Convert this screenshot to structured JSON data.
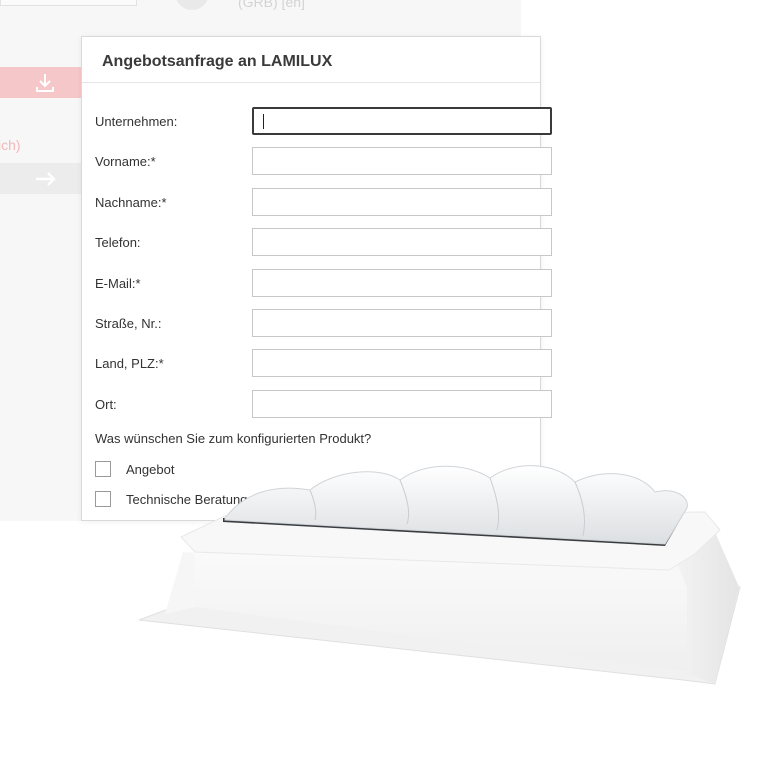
{
  "background": {
    "top_text": "(GRB) [en]",
    "red_text": "ich)",
    "download_icon": "download-icon",
    "arrow_icon": "arrow-right-icon"
  },
  "dialog": {
    "title": "Angebotsanfrage an LAMILUX",
    "fields": [
      {
        "label": "Unternehmen:",
        "value": ""
      },
      {
        "label": "Vorname:*",
        "value": ""
      },
      {
        "label": "Nachname:*",
        "value": ""
      },
      {
        "label": "Telefon:",
        "value": ""
      },
      {
        "label": "E-Mail:*",
        "value": ""
      },
      {
        "label": "Straße, Nr.:",
        "value": ""
      },
      {
        "label": "Land, PLZ:*",
        "value": ""
      },
      {
        "label": "Ort:",
        "value": ""
      }
    ],
    "question": "Was wünschen Sie zum konfigurierten Produkt?",
    "options": [
      {
        "label": "Angebot",
        "checked": false
      },
      {
        "label": "Technische Beratung",
        "checked": false
      }
    ]
  },
  "colors": {
    "accent_pink": "#f6c7c9",
    "text": "#333333"
  }
}
